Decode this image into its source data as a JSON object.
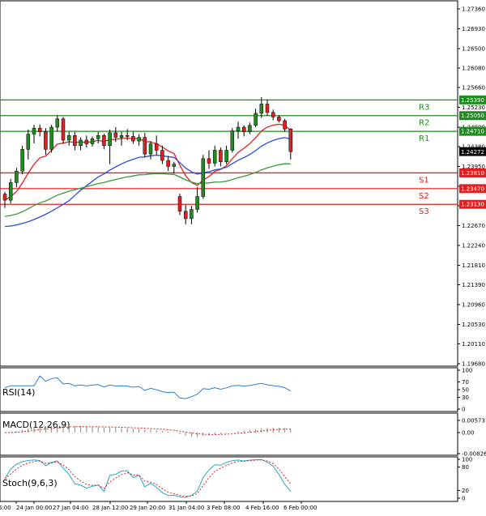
{
  "chart_data": {
    "type": "candlestick",
    "main": {
      "price_ticks": [
        "1.27360",
        "1.26930",
        "1.26500",
        "1.26080",
        "1.25660",
        "1.25230",
        "1.24800",
        "1.24380",
        "1.23950",
        "1.23520",
        "1.23100",
        "1.22670",
        "1.22240",
        "1.21810",
        "1.21390",
        "1.20960",
        "1.20530",
        "1.20110",
        "1.19680"
      ],
      "price_range": [
        1.1968,
        1.2736
      ],
      "current_price": "1.24272",
      "levels": [
        {
          "label": "R3",
          "value": 1.2539,
          "text": "1.25390",
          "color": "#1e8c1e"
        },
        {
          "label": "R2",
          "value": 1.2505,
          "text": "1.25050",
          "color": "#1e8c1e"
        },
        {
          "label": "R1",
          "value": 1.2471,
          "text": "1.24710",
          "color": "#1e8c1e"
        },
        {
          "label": "S1",
          "value": 1.2381,
          "text": "1.23810",
          "color": "#e02020"
        },
        {
          "label": "S2",
          "value": 1.2347,
          "text": "1.23470",
          "color": "#e02020"
        },
        {
          "label": "S3",
          "value": 1.2313,
          "text": "1.23130",
          "color": "#e02020"
        }
      ],
      "candles": [
        [
          1.2335,
          1.234,
          1.2305,
          1.2322
        ],
        [
          1.2322,
          1.2368,
          1.2315,
          1.236
        ],
        [
          1.236,
          1.2392,
          1.235,
          1.2385
        ],
        [
          1.2385,
          1.244,
          1.2378,
          1.2432
        ],
        [
          1.2432,
          1.2475,
          1.241,
          1.2465
        ],
        [
          1.2465,
          1.2485,
          1.2445,
          1.2478
        ],
        [
          1.2478,
          1.2486,
          1.246,
          1.247
        ],
        [
          1.247,
          1.2478,
          1.242,
          1.2432
        ],
        [
          1.2432,
          1.2485,
          1.2425,
          1.248
        ],
        [
          1.248,
          1.2505,
          1.247,
          1.2498
        ],
        [
          1.2498,
          1.2502,
          1.2445,
          1.2452
        ],
        [
          1.2452,
          1.247,
          1.244,
          1.2462
        ],
        [
          1.2462,
          1.247,
          1.243,
          1.244
        ],
        [
          1.244,
          1.2458,
          1.243,
          1.2452
        ],
        [
          1.2452,
          1.2462,
          1.2436,
          1.2444
        ],
        [
          1.2444,
          1.246,
          1.2438,
          1.2455
        ],
        [
          1.2455,
          1.247,
          1.2445,
          1.2462
        ],
        [
          1.2462,
          1.2466,
          1.2432,
          1.244
        ],
        [
          1.244,
          1.2475,
          1.24,
          1.2468
        ],
        [
          1.2468,
          1.248,
          1.2448,
          1.2458
        ],
        [
          1.2458,
          1.247,
          1.244,
          1.2462
        ],
        [
          1.2462,
          1.2476,
          1.2452,
          1.246
        ],
        [
          1.246,
          1.247,
          1.2444,
          1.245
        ],
        [
          1.245,
          1.2465,
          1.244,
          1.2458
        ],
        [
          1.2458,
          1.2468,
          1.2415,
          1.2422
        ],
        [
          1.2422,
          1.245,
          1.241,
          1.2444
        ],
        [
          1.2444,
          1.2462,
          1.242,
          1.243
        ],
        [
          1.243,
          1.244,
          1.24,
          1.2408
        ],
        [
          1.2408,
          1.2418,
          1.2385,
          1.2395
        ],
        [
          1.2395,
          1.2405,
          1.238,
          1.24
        ],
        [
          1.233,
          1.2336,
          1.229,
          1.2298
        ],
        [
          1.2298,
          1.2312,
          1.227,
          1.2282
        ],
        [
          1.2282,
          1.231,
          1.227,
          1.2302
        ],
        [
          1.2302,
          1.235,
          1.2295,
          1.233
        ],
        [
          1.233,
          1.242,
          1.2325,
          1.2412
        ],
        [
          1.2412,
          1.243,
          1.239,
          1.2402
        ],
        [
          1.2402,
          1.244,
          1.2395,
          1.243
        ],
        [
          1.243,
          1.2436,
          1.2395,
          1.2405
        ],
        [
          1.2405,
          1.244,
          1.24,
          1.243
        ],
        [
          1.243,
          1.2478,
          1.2425,
          1.2472
        ],
        [
          1.2472,
          1.2492,
          1.2455,
          1.248
        ],
        [
          1.248,
          1.2484,
          1.246,
          1.247
        ],
        [
          1.247,
          1.249,
          1.2465,
          1.2484
        ],
        [
          1.2484,
          1.252,
          1.248,
          1.251
        ],
        [
          1.251,
          1.2545,
          1.25,
          1.253
        ],
        [
          1.253,
          1.254,
          1.2505,
          1.2512
        ],
        [
          1.2512,
          1.2518,
          1.2495,
          1.2502
        ],
        [
          1.2502,
          1.2506,
          1.249,
          1.2494
        ],
        [
          1.2494,
          1.2498,
          1.247,
          1.2476
        ],
        [
          1.2476,
          1.2478,
          1.241,
          1.2427
        ]
      ]
    },
    "time_labels": [
      "6:00",
      "24 Jan 00:00",
      "27 Jan 04:00",
      "28 Jan 12:00",
      "29 Jan 20:00",
      "31 Jan 04:00",
      "3 Feb 08:00",
      "4 Feb 16:00",
      "6 Feb 00:00"
    ],
    "rsi": {
      "label": "RSI(14)",
      "ticks": [
        "100",
        "70",
        "50",
        "30",
        "0"
      ]
    },
    "macd": {
      "label": "MACD(12,26,9)",
      "ticks": [
        "0.005731",
        "0.00",
        "-0.008266"
      ]
    },
    "stoch": {
      "label": "Stoch(9,6,3)",
      "ticks": [
        "100",
        "80",
        "20",
        "0"
      ]
    }
  }
}
